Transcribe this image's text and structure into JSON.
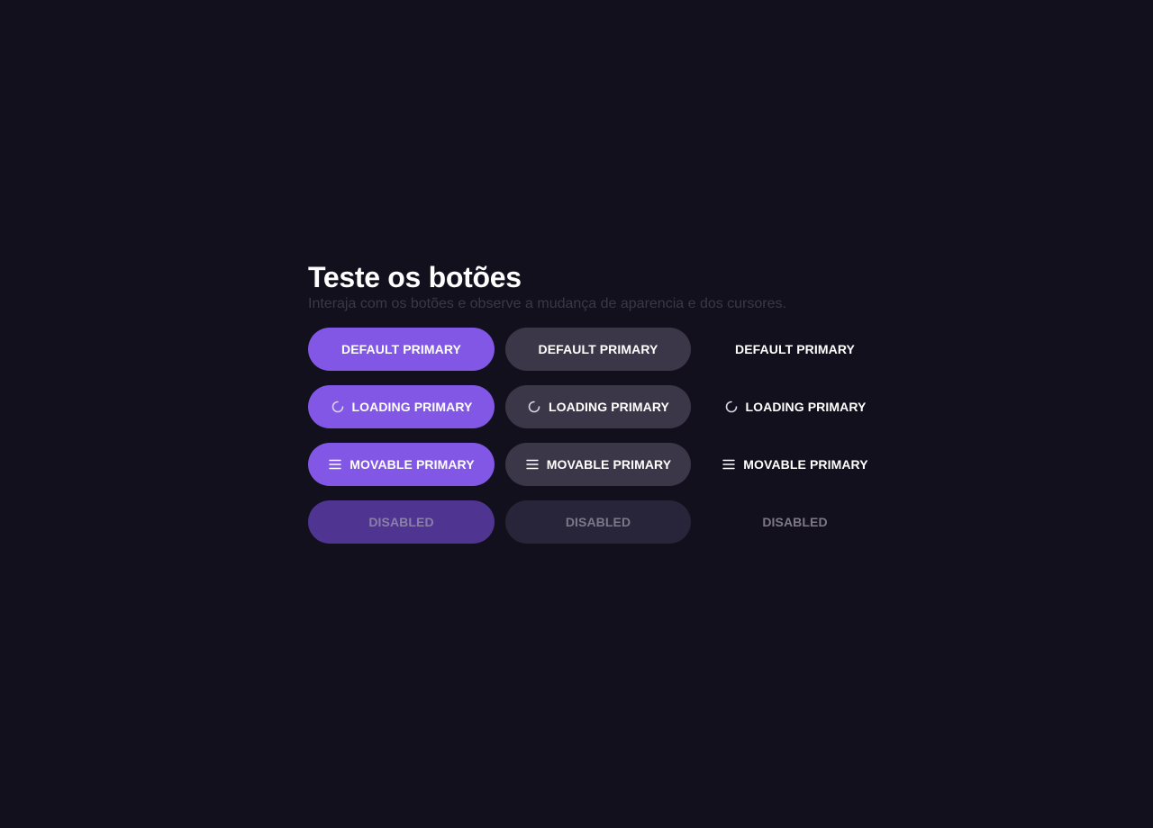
{
  "header": {
    "title": "Teste os botões",
    "subtitle": "Interaja com os botões e observe a mudança de aparencia e dos cursores."
  },
  "colors": {
    "background": "#13101d",
    "primary": "#8257e5",
    "secondary": "#3b3749",
    "subtitle": "#3b3749"
  },
  "buttons": {
    "default_primary": {
      "label": "DEFAULT PRIMARY"
    },
    "default_secondary": {
      "label": "DEFAULT PRIMARY"
    },
    "default_tertiary": {
      "label": "DEFAULT PRIMARY"
    },
    "loading_primary": {
      "label": "LOADING PRIMARY",
      "icon": "spinner-icon"
    },
    "loading_secondary": {
      "label": "LOADING PRIMARY",
      "icon": "spinner-icon"
    },
    "loading_tertiary": {
      "label": "LOADING PRIMARY",
      "icon": "spinner-icon"
    },
    "movable_primary": {
      "label": "MOVABLE PRIMARY",
      "icon": "drag-handle-icon"
    },
    "movable_secondary": {
      "label": "MOVABLE PRIMARY",
      "icon": "drag-handle-icon"
    },
    "movable_tertiary": {
      "label": "MOVABLE PRIMARY",
      "icon": "drag-handle-icon"
    },
    "disabled_primary": {
      "label": "DISABLED"
    },
    "disabled_secondary": {
      "label": "DISABLED"
    },
    "disabled_tertiary": {
      "label": "DISABLED"
    }
  }
}
